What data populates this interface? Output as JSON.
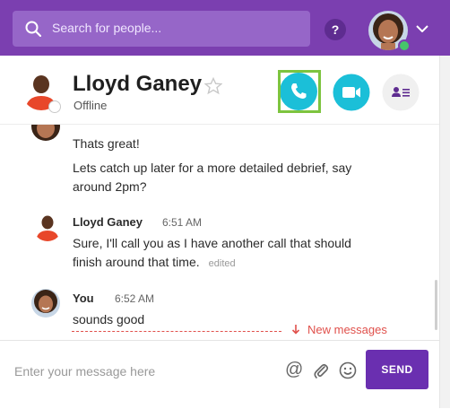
{
  "topbar": {
    "search_placeholder": "Search for people...",
    "help_label": "?"
  },
  "contact": {
    "name": "Lloyd Ganey",
    "status": "Offline"
  },
  "messages": [
    {
      "text": "Thats great!"
    },
    {
      "text": "Lets catch up later for a more detailed debrief, say around 2pm?"
    },
    {
      "sender": "Lloyd Ganey",
      "time": "6:51 AM",
      "text": "Sure, I'll call you as I have another call that should finish around that time.",
      "edited": "edited"
    },
    {
      "sender": "You",
      "time": "6:52 AM",
      "text": "sounds good"
    }
  ],
  "new_messages_label": "New messages",
  "composer": {
    "placeholder": "Enter your message here",
    "send_label": "SEND"
  },
  "colors": {
    "brand_purple": "#7b3fb0",
    "call_cyan": "#1bbfd8",
    "highlight_green": "#7dc43f",
    "new_messages_red": "#e0504b"
  },
  "icons": [
    "search-icon",
    "help-icon",
    "chevron-down-icon",
    "star-icon",
    "phone-icon",
    "video-icon",
    "profile-card-icon",
    "arrow-down-icon",
    "at-icon",
    "paperclip-icon",
    "smiley-icon"
  ]
}
